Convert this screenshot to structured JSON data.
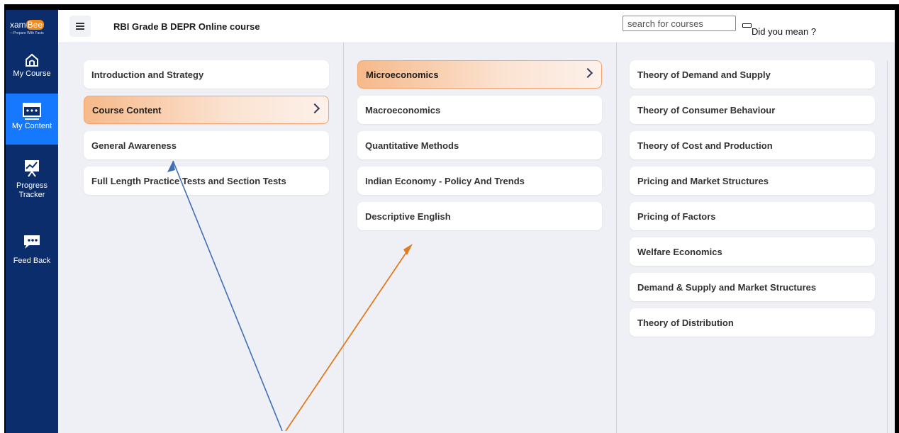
{
  "app": {
    "logo_text": "xam",
    "logo_badge": "Bee",
    "logo_tagline": "—Prepare With Facts",
    "title": "RBI Grade B DEPR Online course"
  },
  "sidebar": {
    "items": [
      {
        "label": "My Course",
        "icon": "home-icon",
        "active": false
      },
      {
        "label": "My Content",
        "icon": "board-icon",
        "active": true
      },
      {
        "label": "Progress Tracker",
        "icon": "chart-icon",
        "active": false
      },
      {
        "label": "Feed Back",
        "icon": "chat-icon",
        "active": false
      }
    ]
  },
  "search": {
    "placeholder": "search for courses",
    "did_you_mean": "Did you mean ?"
  },
  "column1": [
    {
      "label": "Introduction and Strategy",
      "selected": false
    },
    {
      "label": "Course Content",
      "selected": true
    },
    {
      "label": "General Awareness",
      "selected": false
    },
    {
      "label": "Full Length Practice Tests and Section Tests",
      "selected": false
    }
  ],
  "column2": [
    {
      "label": "Microeconomics",
      "selected": true
    },
    {
      "label": "Macroeconomics",
      "selected": false
    },
    {
      "label": "Quantitative Methods",
      "selected": false
    },
    {
      "label": "Indian Economy - Policy And Trends",
      "selected": false
    },
    {
      "label": "Descriptive English",
      "selected": false
    }
  ],
  "column3": [
    {
      "label": "Theory of Demand and Supply",
      "selected": false
    },
    {
      "label": "Theory of Consumer Behaviour",
      "selected": false
    },
    {
      "label": "Theory of Cost and Production",
      "selected": false
    },
    {
      "label": "Pricing and Market Structures",
      "selected": false
    },
    {
      "label": "Pricing of Factors",
      "selected": false
    },
    {
      "label": "Welfare Economics",
      "selected": false
    },
    {
      "label": "Demand & Supply and Market Structures",
      "selected": false
    },
    {
      "label": "Theory of Distribution",
      "selected": false
    }
  ],
  "colors": {
    "sidebar": "#0b2d6b",
    "active_nav": "#1677ff",
    "selected_gradient_start": "#f6b98a",
    "annotation_blue": "#3f6fb5",
    "annotation_orange": "#e07b1f"
  }
}
